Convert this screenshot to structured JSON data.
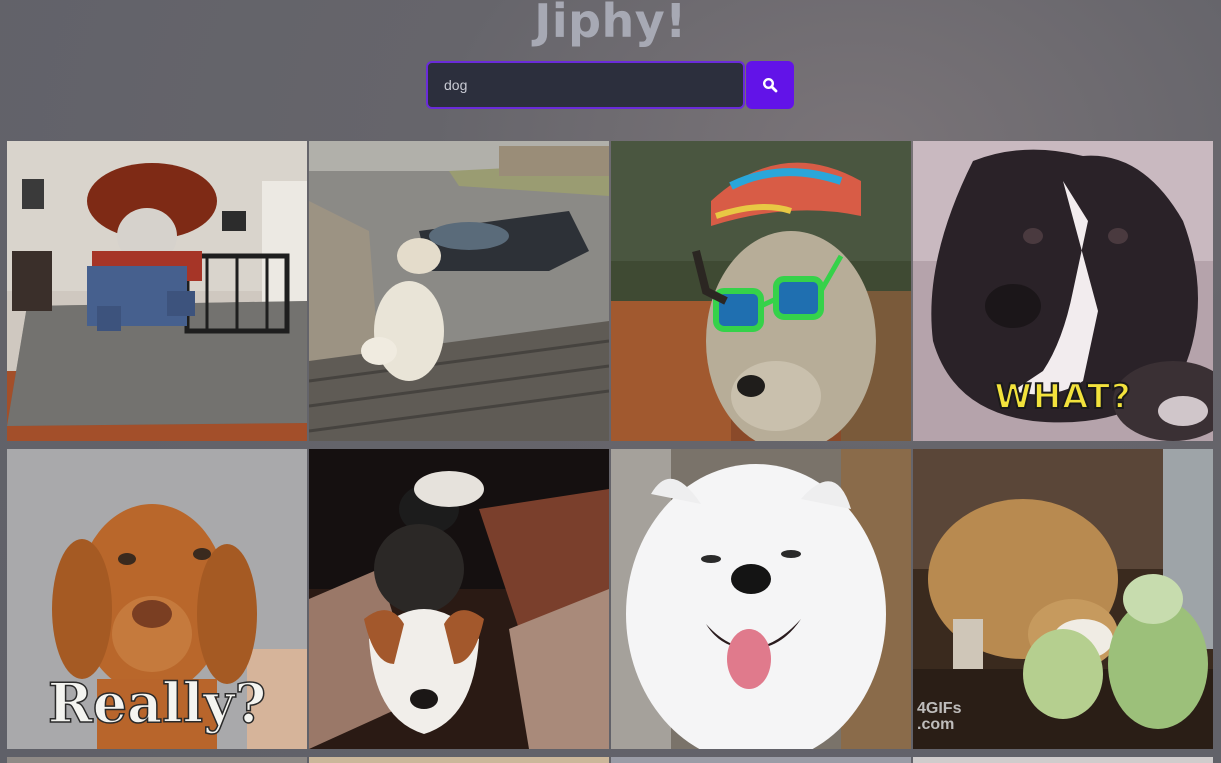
{
  "header": {
    "title": "Jiphy!"
  },
  "search": {
    "value": "dog",
    "button_icon": "search-icon"
  },
  "results": [
    {
      "name": "gif-dog-costume-jumping",
      "caption": ""
    },
    {
      "name": "gif-dog-on-porch",
      "caption": ""
    },
    {
      "name": "gif-dog-hat-sunglasses",
      "caption": ""
    },
    {
      "name": "gif-dog-what",
      "caption": "WHAT?"
    },
    {
      "name": "gif-puppy-really",
      "caption": "Really?"
    },
    {
      "name": "gif-jack-russell-couch",
      "caption": ""
    },
    {
      "name": "gif-samoyed-smiling",
      "caption": ""
    },
    {
      "name": "gif-dog-cabbage",
      "caption": "",
      "watermark": "4GIFs\n.com"
    }
  ],
  "colors": {
    "accent": "#6213e8",
    "input_border": "#6a2bd9",
    "input_bg": "#2c2f3d",
    "title": "#a7a9b4"
  }
}
